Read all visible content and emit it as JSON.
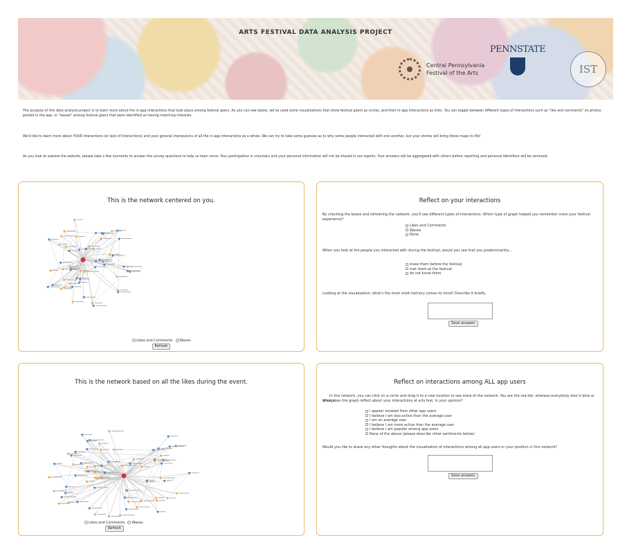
{
  "header": {
    "title": "ARTS FESTIVAL DATA ANALYSIS PROJECT",
    "cpfa_line1": "Central Pennsylvania",
    "cpfa_line2": "Festival of the Arts",
    "psu_word": "PENNSTATE",
    "ist_mark": "IST"
  },
  "intro": {
    "p1": "The purpose of this data analysis project is to learn more about the in-app interactions that took place among festival goers. As you can see below, we've used some visualizations that show festival goers as circles, and their in-app interactions as links. You can toggle between different types of interactions such as \"like and comments\" on photos posted in the app, or \"waves\" among festival goers that were identified as having matching interests.",
    "p2": "We'd like to learn more about YOUR interactions (or lack of interactions) and your general impressions of all the in-app interactions as a whole. We can try to take some guesses as to why some people interacted with one another, but your stories will bring these maps to life!",
    "p3": "As you look at explore the website, please take a few moments to answer the survey questions to help us learn more. Your participation is voluntary and your personal information will not be shared in our reports. Your answers will be aggregated with others before reporting and personal identifiers will be removed."
  },
  "panel1": {
    "title": "This is the network centered on you.",
    "opt_likes": "Likes and Comments",
    "opt_waves": "Waves",
    "refresh": "Refresh"
  },
  "panel2": {
    "title": "Reflect on your interactions",
    "q1": "By checking the boxes and refreshing the network, you'll see different types of interactions. Which type of graph helped you remember more your festival experience?",
    "q1_options": [
      "Likes and Comments",
      "Waves",
      "None"
    ],
    "q2": "When you look at the people you interacted with during the festival, would you see that you predominantly...",
    "q2_options": [
      "knew them before the festival",
      "met them at the festival",
      "do not know them"
    ],
    "q3": "Looking at the visualization, what's the most vivid memory comes to mind? Describe it briefly.",
    "save": "Save answers"
  },
  "panel3": {
    "title": "This is the network based on all the likes during the event.",
    "opt_likes": "Likes and Comments",
    "opt_waves": "Waves",
    "refresh": "Refresh"
  },
  "panel4": {
    "title": "Reflect on interactions among ALL app users",
    "intro": "In this network, you can click on a circle and drag it to a new location to see more of the network. You are the red dot, whereas everybody else is blue or orange.",
    "q1": "What does the graph reflect about your interactions at arts fest, in your opinion?",
    "q1_options": [
      "I appear isolated from other app users",
      "I believe I am less active than the average user",
      "I am an average user",
      "I believe I am more active than the average user",
      "I believe I am popular among app users",
      "None of the above (please describe other sentiments below)"
    ],
    "q2": "Would you like to share any other thoughts about the visualization of interactions among all app users or your position in this network?",
    "save": "Save answers"
  },
  "colors": {
    "panel_border": "#e8b96a",
    "node_blue": "#4a7fb5",
    "node_orange": "#f0a04b",
    "node_red": "#cc3344",
    "link": "#c8c8c8"
  }
}
